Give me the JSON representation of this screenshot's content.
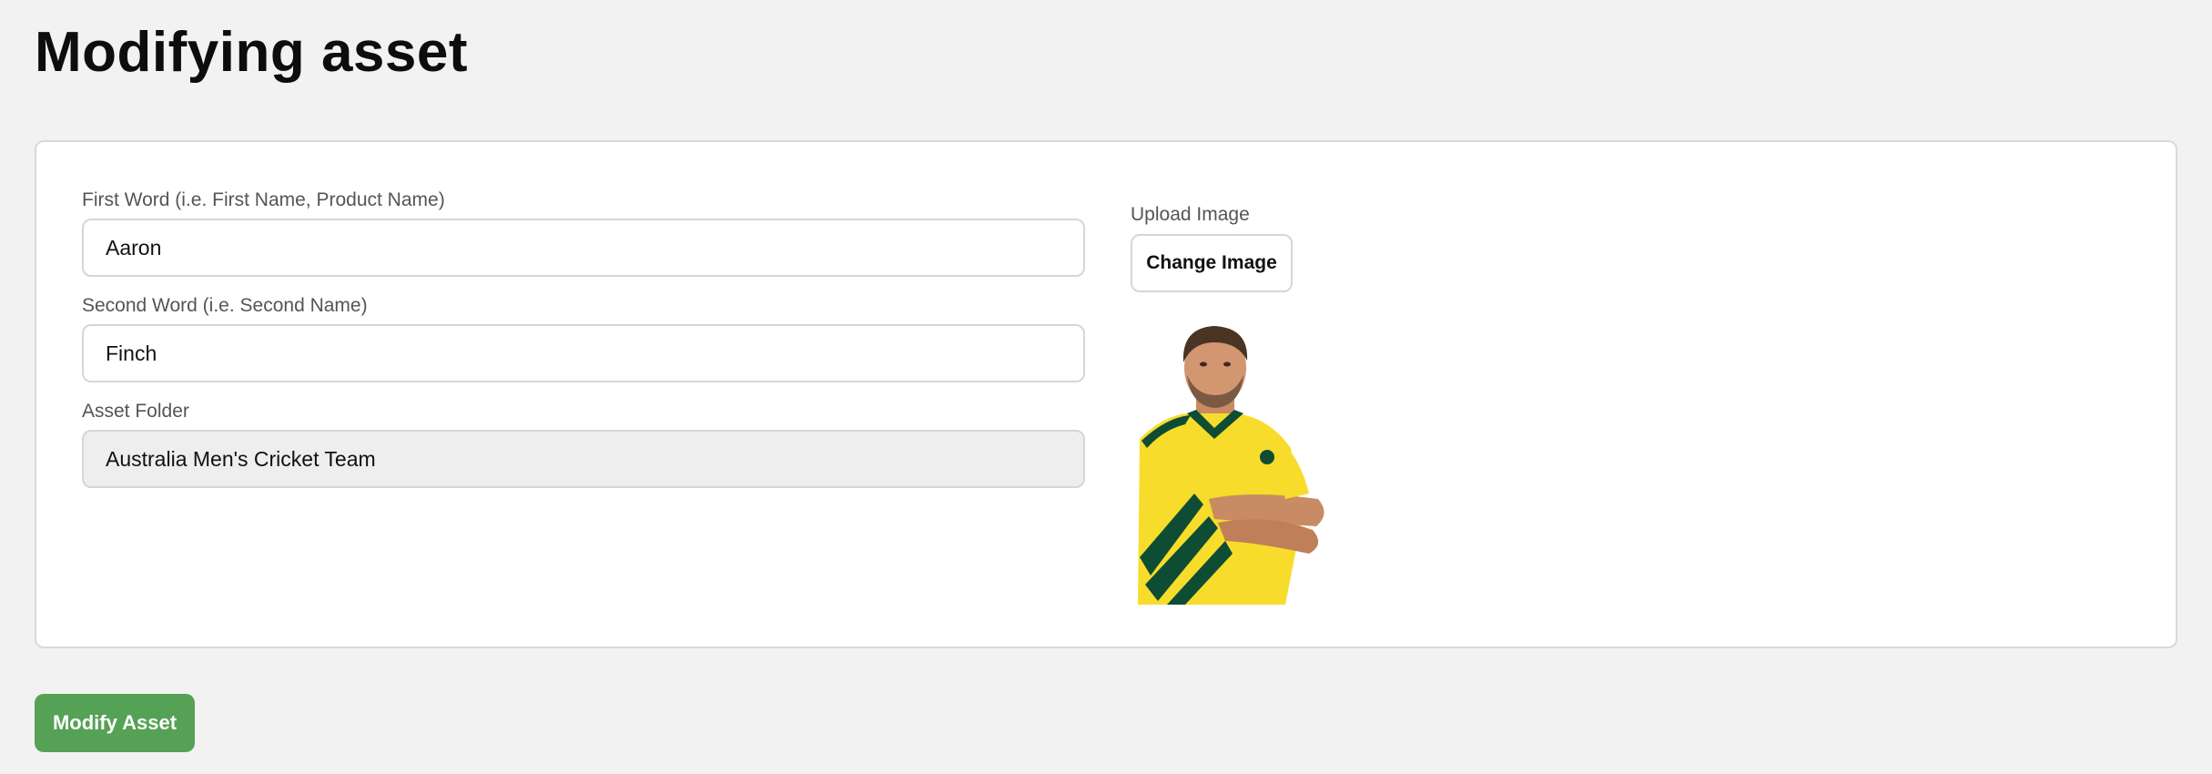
{
  "page": {
    "title": "Modifying asset"
  },
  "form": {
    "first_word": {
      "label": "First Word (i.e. First Name, Product Name)",
      "value": "Aaron"
    },
    "second_word": {
      "label": "Second Word (i.e. Second Name)",
      "value": "Finch"
    },
    "asset_folder": {
      "label": "Asset Folder",
      "value": "Australia Men's Cricket Team"
    },
    "upload": {
      "label": "Upload Image",
      "button_label": "Change Image"
    },
    "image": {
      "icon": "player-photo"
    }
  },
  "actions": {
    "modify_label": "Modify Asset"
  },
  "colors": {
    "primary_button": "#55a155",
    "page_background": "#f2f2f2",
    "jersey_yellow": "#f7dc2c",
    "jersey_green": "#0e4d33"
  }
}
